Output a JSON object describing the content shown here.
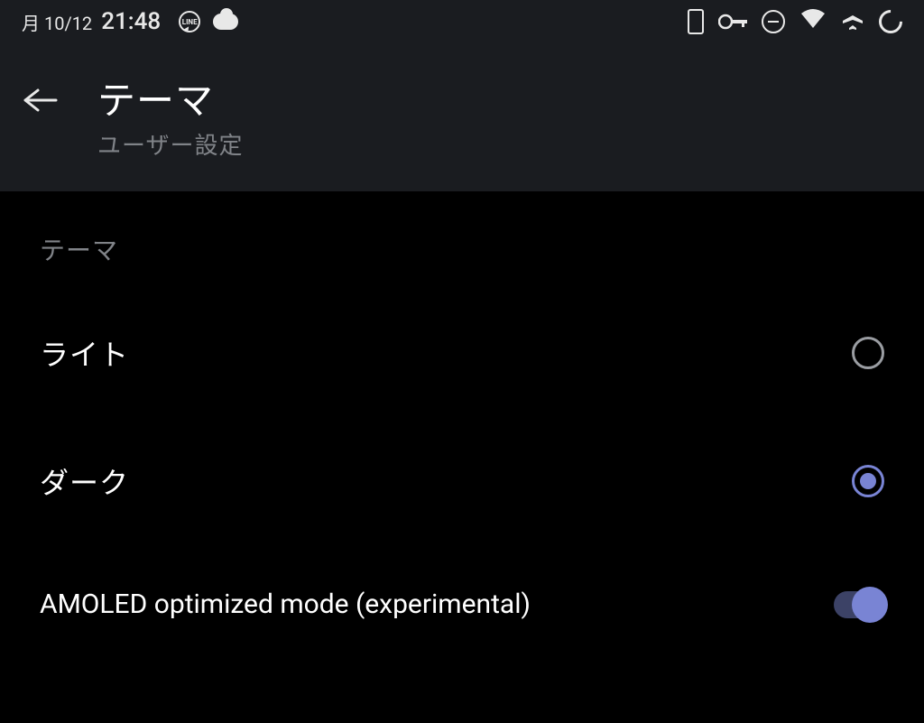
{
  "statusBar": {
    "date": "月 10/12",
    "time": "21:48"
  },
  "header": {
    "title": "テーマ",
    "subtitle": "ユーザー設定"
  },
  "content": {
    "sectionHeader": "テーマ",
    "options": [
      {
        "label": "ライト",
        "selected": false
      },
      {
        "label": "ダーク",
        "selected": true
      }
    ],
    "amoledOption": {
      "label": "AMOLED optimized mode (experimental)",
      "enabled": true
    }
  }
}
